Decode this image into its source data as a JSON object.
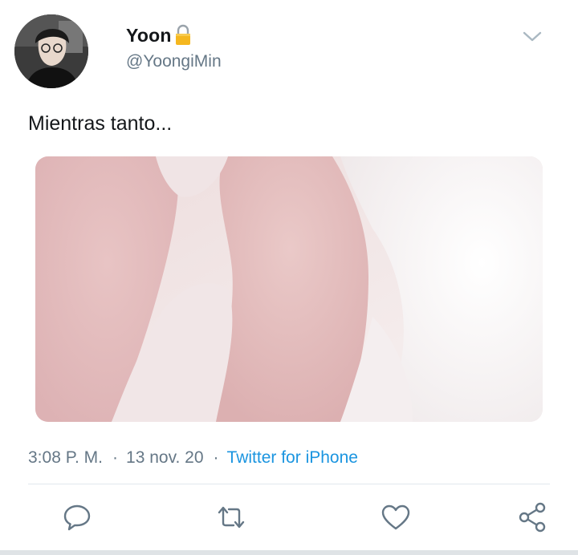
{
  "tweet": {
    "user": {
      "name": "Yoon",
      "handle": "@YoongiMin",
      "protected_icon": "lock-icon",
      "avatar_icon": "avatar-photo"
    },
    "text": "Mientras tanto...",
    "media": {
      "description_icon": "photo"
    },
    "meta": {
      "time": "3:08 P. M.",
      "separator": "·",
      "date": "13 nov. 20",
      "source": "Twitter for iPhone"
    },
    "actions": {
      "reply_icon": "reply-icon",
      "retweet_icon": "retweet-icon",
      "like_icon": "heart-icon",
      "share_icon": "share-icon"
    },
    "colors": {
      "text": "#14171a",
      "secondary": "#657786",
      "link": "#1b95e0",
      "icon": "#657786",
      "divider": "#e1e8ed"
    }
  }
}
